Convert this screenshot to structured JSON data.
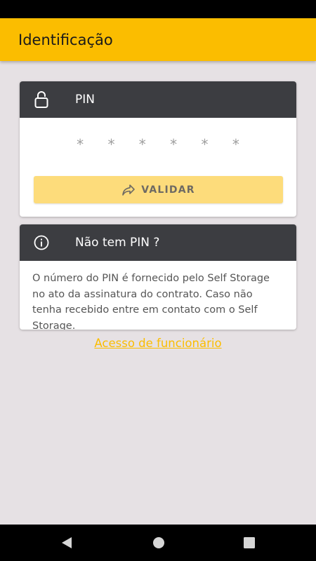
{
  "app_bar": {
    "title": "Identificação"
  },
  "pin_card": {
    "title": "PIN",
    "icon": "lock-icon",
    "pin_mask": "* * * * * *",
    "validate_label": "VALIDAR",
    "validate_icon": "share-forward-icon"
  },
  "info_card": {
    "title": "Não tem PIN ?",
    "icon": "info-icon",
    "text": "O número do PIN é fornecido pelo Self Storage no ato da assinatura do contrato. Caso não tenha recebido entre em contato com o Self Storage."
  },
  "staff_link": {
    "label": "Acesso de funcionário"
  },
  "colors": {
    "primary": "#fbbd00",
    "card_header": "#3c3d41",
    "button_disabled": "#fddc7b",
    "background": "#e6e1e4"
  },
  "nav_bar": {
    "back_icon": "back-triangle-icon",
    "home_icon": "home-circle-icon",
    "recent_icon": "recent-square-icon"
  }
}
